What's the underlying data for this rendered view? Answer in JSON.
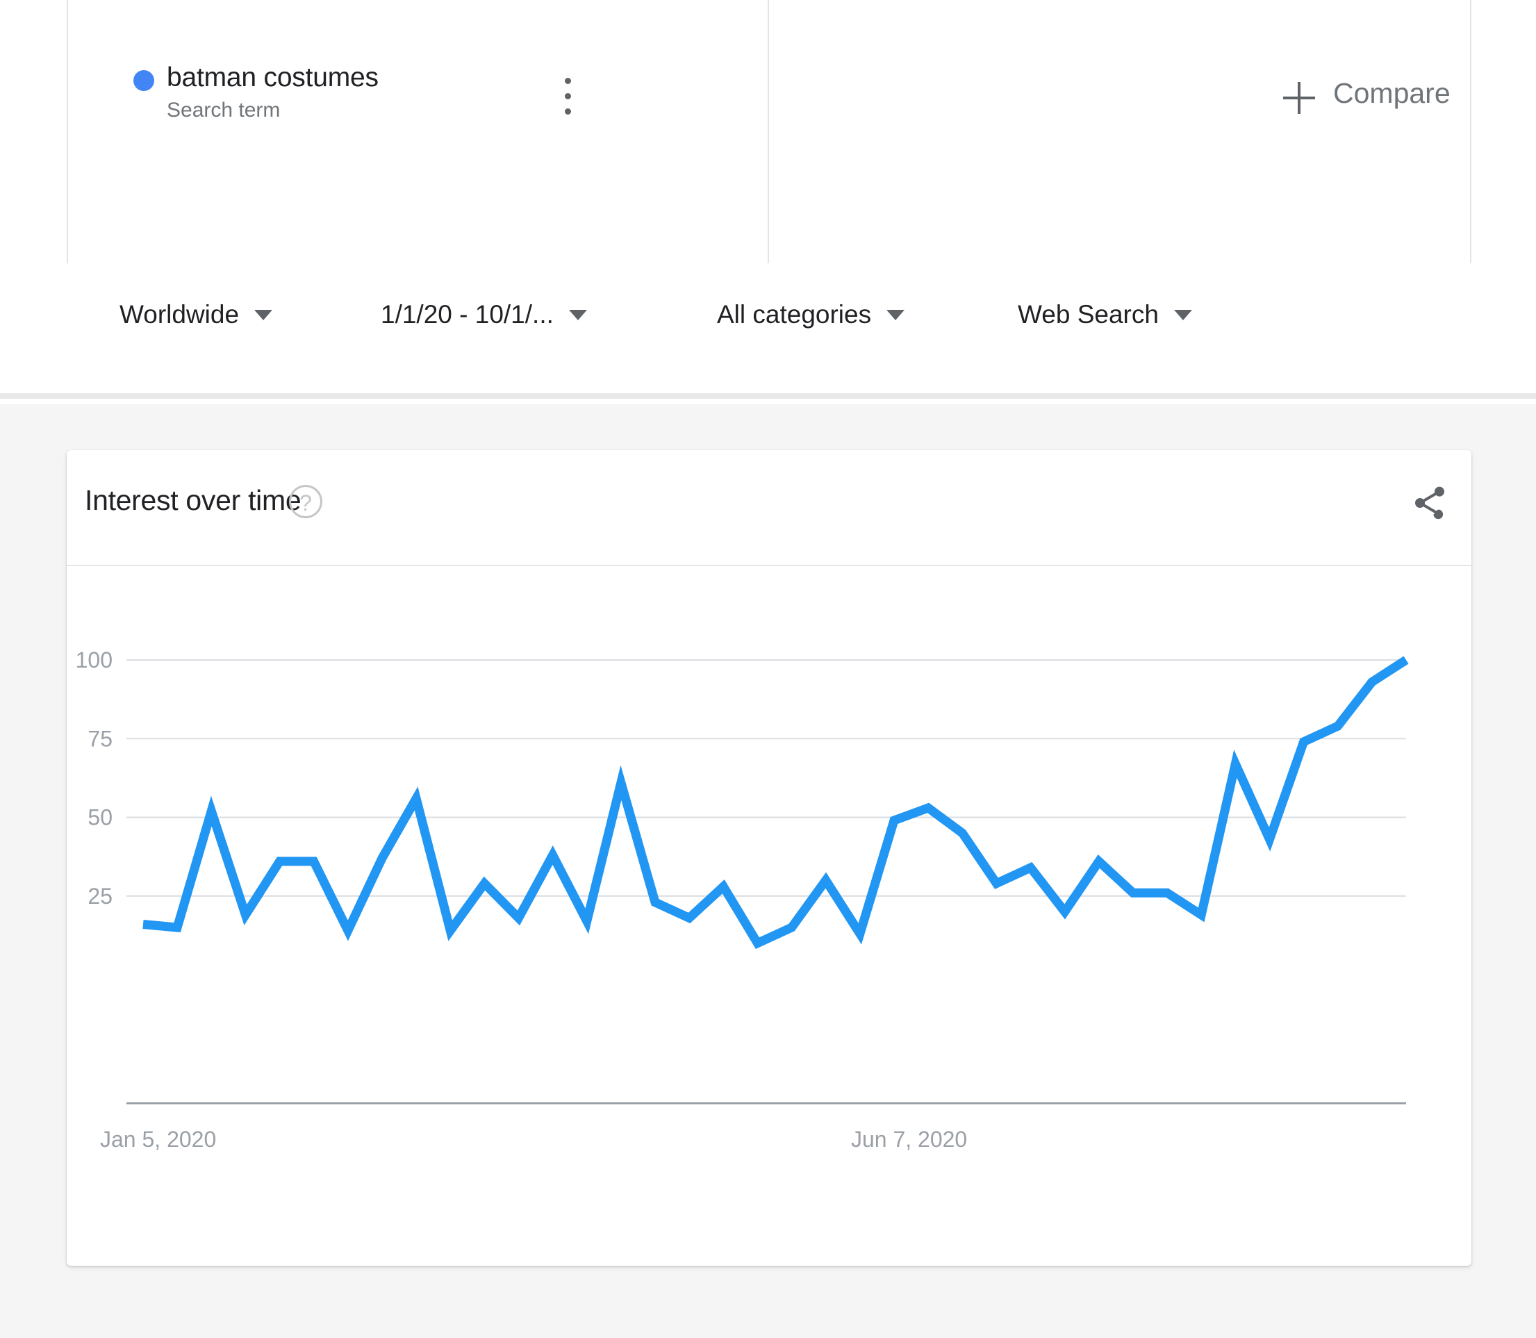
{
  "term": {
    "label": "batman costumes",
    "sublabel": "Search term",
    "dot_color": "#4285f4",
    "menu_icon": "kebab-menu-icon"
  },
  "compare": {
    "label": "Compare",
    "plus_icon": "plus-icon"
  },
  "filters": [
    {
      "label": "Worldwide"
    },
    {
      "label": "1/1/20 - 10/1/..."
    },
    {
      "label": "All categories"
    },
    {
      "label": "Web Search"
    }
  ],
  "card": {
    "title": "Interest over time",
    "help_icon": "help-circle-icon",
    "help_glyph": "?",
    "share_icon": "share-icon"
  },
  "chart_data": {
    "type": "line",
    "title": "Interest over time",
    "xlabel": "",
    "ylabel": "",
    "ylim": [
      0,
      100
    ],
    "yticks": [
      25,
      50,
      75,
      100
    ],
    "ytick_labels": [
      "25",
      "50",
      "75",
      "100"
    ],
    "xtick_labels": [
      "Jan 5, 2020",
      "Jun 7, 2020"
    ],
    "xtick_positions": [
      0,
      22
    ],
    "grid": true,
    "legend": false,
    "line_color": "#2196f3",
    "series": [
      {
        "name": "batman costumes",
        "values": [
          16,
          15,
          52,
          19,
          36,
          36,
          14,
          37,
          56,
          14,
          29,
          18,
          38,
          17,
          61,
          23,
          18,
          28,
          10,
          15,
          30,
          13,
          49,
          53,
          45,
          29,
          34,
          20,
          36,
          26,
          26,
          19,
          67,
          43,
          74,
          79,
          93,
          100
        ]
      }
    ]
  }
}
